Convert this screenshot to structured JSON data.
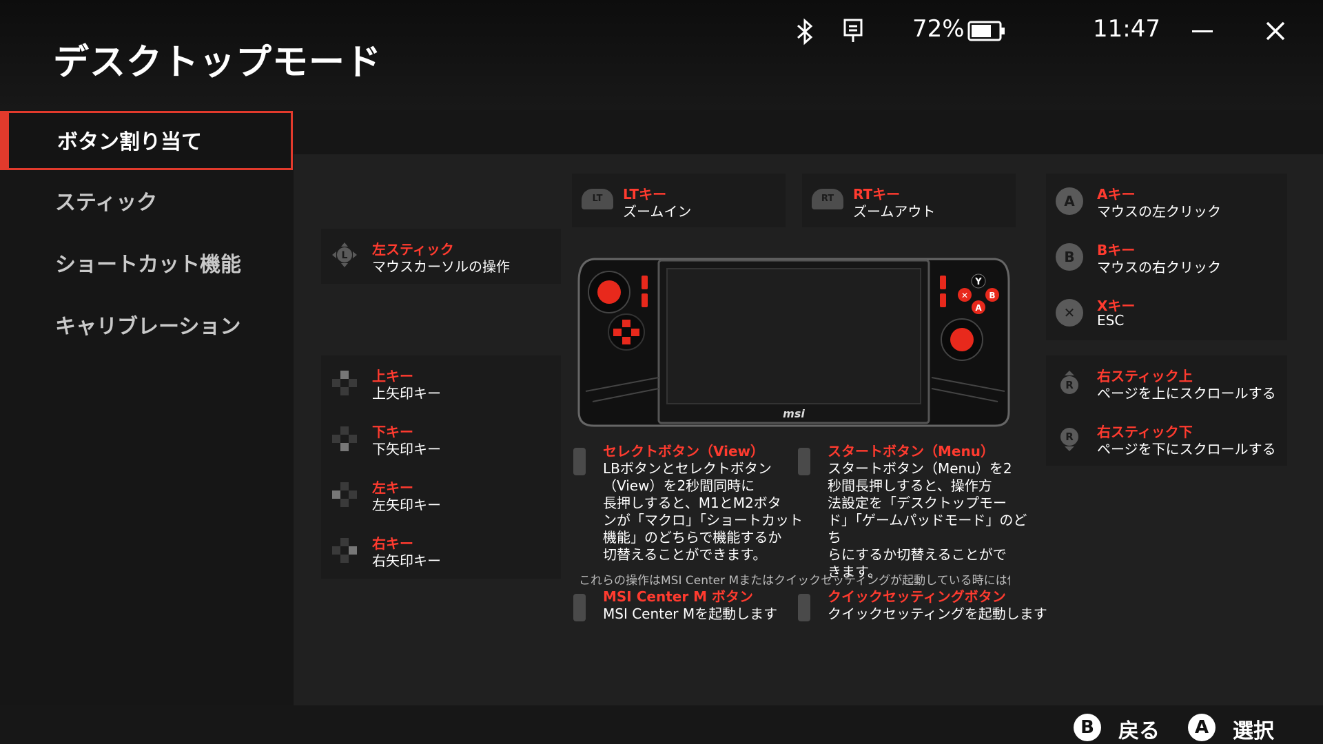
{
  "app_title": "デスクトップモード",
  "status": {
    "battery": "72%",
    "time": "11:47"
  },
  "sidebar": {
    "items": [
      {
        "label": "ボタン割り当て"
      },
      {
        "label": "スティック"
      },
      {
        "label": "ショートカット機能"
      },
      {
        "label": "キャリブレーション"
      }
    ]
  },
  "mapping": {
    "lt": {
      "label": "LTキー",
      "desc": "ズームイン",
      "icon_text": "LT"
    },
    "rt": {
      "label": "RTキー",
      "desc": "ズームアウト",
      "icon_text": "RT"
    },
    "left_stick": {
      "label": "左スティック",
      "desc": "マウスカーソルの操作"
    },
    "up": {
      "label": "上キー",
      "desc": "上矢印キー"
    },
    "down": {
      "label": "下キー",
      "desc": "下矢印キー"
    },
    "left": {
      "label": "左キー",
      "desc": "左矢印キー"
    },
    "right": {
      "label": "右キー",
      "desc": "右矢印キー"
    },
    "a": {
      "label": "Aキー",
      "desc": "マウスの左クリック",
      "icon_text": "A"
    },
    "b": {
      "label": "Bキー",
      "desc": "マウスの右クリック",
      "icon_text": "B"
    },
    "x": {
      "label": "Xキー",
      "desc": "ESC",
      "icon_text": "✕"
    },
    "rs_up": {
      "label": "右スティック上",
      "desc": "ページを上にスクロールする"
    },
    "rs_down": {
      "label": "右スティック下",
      "desc": "ページを下にスクロールする"
    }
  },
  "device": {
    "brand": "msi",
    "y_label": "Y",
    "x_label": "✕",
    "b_label": "B",
    "a_label": "A"
  },
  "select_button": {
    "title": "セレクトボタン（View）",
    "lines": [
      "LBボタンとセレクトボタン",
      "（View）を2秒間同時に",
      "長押しすると、M1とM2ボタ",
      "ンが「マクロ」「ショートカット",
      "機能」のどちらで機能するか",
      "切替えることができます。"
    ]
  },
  "start_button": {
    "title": "スタートボタン（Menu）",
    "lines": [
      "スタートボタン（Menu）を2",
      "秒間長押しすると、操作方",
      "法設定を「デスクトップモー",
      "ド」「ゲームパッドモード」のどち",
      "らにするか切替えることがで",
      "きます。"
    ]
  },
  "note": "これらの操作はMSI Center Mまたはクイックセッティングが起動している時には使",
  "msi_button": {
    "title": "MSI Center M ボタン",
    "desc": "MSI Center Mを起動します"
  },
  "quick_button": {
    "title": "クイックセッティングボタン",
    "desc": "クイックセッティングを起動します"
  },
  "footer": {
    "back_key": "B",
    "back_label": "戻る",
    "select_key": "A",
    "select_label": "選択"
  }
}
